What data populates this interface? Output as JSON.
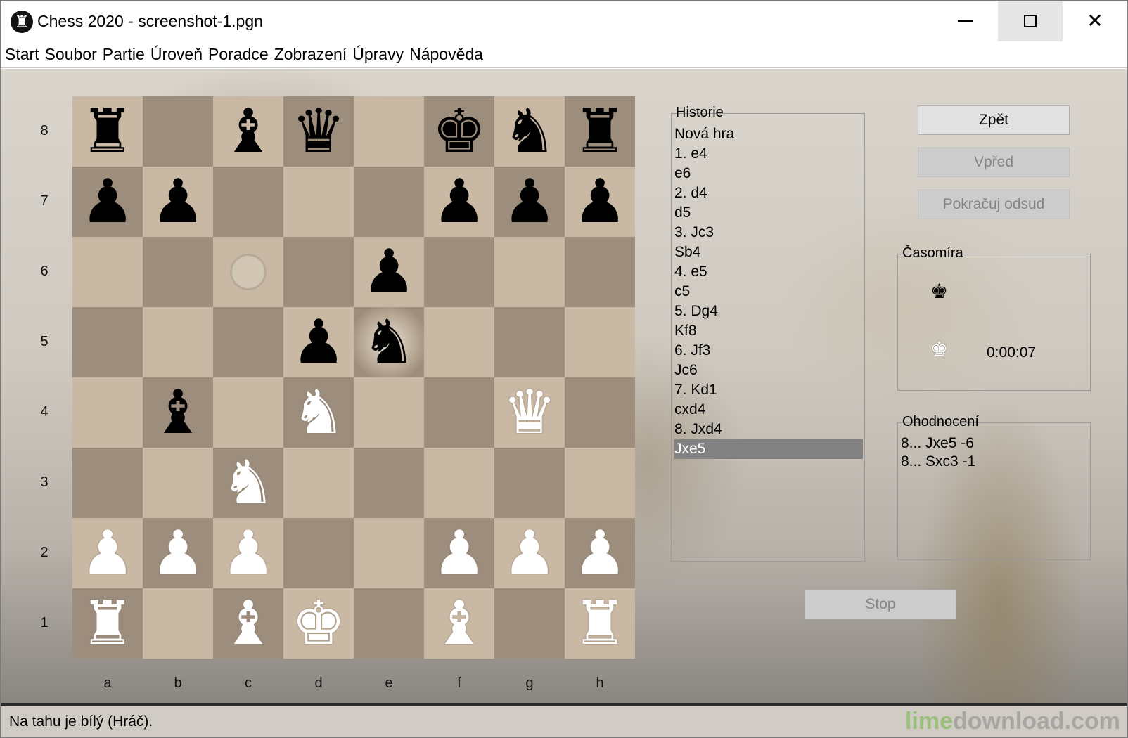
{
  "window": {
    "title": "Chess 2020 - screenshot-1.pgn",
    "app_icon": "♜",
    "close_glyph": "✕"
  },
  "menu": [
    "Start",
    "Soubor",
    "Partie",
    "Úroveň",
    "Poradce",
    "Zobrazení",
    "Úpravy",
    "Nápověda"
  ],
  "board": {
    "colors": {
      "light": "#c9b8a3",
      "dark": "#9d8d7d"
    },
    "ranks": [
      "8",
      "7",
      "6",
      "5",
      "4",
      "3",
      "2",
      "1"
    ],
    "files": [
      "a",
      "b",
      "c",
      "d",
      "e",
      "f",
      "g",
      "h"
    ],
    "pieces": {
      "a8": "br",
      "c8": "bb",
      "d8": "bq",
      "f8": "bk",
      "g8": "bn",
      "h8": "br",
      "a7": "bp",
      "b7": "bp",
      "f7": "bp",
      "g7": "bp",
      "h7": "bp",
      "e6": "bp",
      "d5": "bp",
      "e5": "bn",
      "b4": "bb",
      "d4": "wn",
      "g4": "wq",
      "c3": "wn",
      "a2": "wp",
      "b2": "wp",
      "c2": "wp",
      "f2": "wp",
      "g2": "wp",
      "h2": "wp",
      "a1": "wr",
      "c1": "wb",
      "d1": "wk",
      "f1": "wb",
      "h1": "wr"
    },
    "last_move_square": "e5",
    "hint_square": "c6"
  },
  "history": {
    "title": "Historie",
    "moves": [
      "Nová hra",
      "1. e4",
      "e6",
      "2. d4",
      "d5",
      "3. Jc3",
      "Sb4",
      "4. e5",
      "c5",
      "5. Dg4",
      "Kf8",
      "6. Jf3",
      "Jc6",
      "7. Kd1",
      "cxd4",
      "8. Jxd4",
      "Jxe5"
    ],
    "selected_index": 16
  },
  "buttons": {
    "back": "Zpět",
    "forward": "Vpřed",
    "continue": "Pokračuj odsud",
    "stop": "Stop"
  },
  "clock": {
    "title": "Časomíra",
    "black_icon": "♚",
    "white_icon": "♚",
    "white_time": "0:00:07"
  },
  "evaluation": {
    "title": "Ohodnocení",
    "lines": [
      "8... Jxe5 -6",
      "8... Sxc3 -1"
    ]
  },
  "status": {
    "text": "Na tahu je bílý (Hráč).",
    "watermark_a": "lime",
    "watermark_b": "download.com"
  }
}
